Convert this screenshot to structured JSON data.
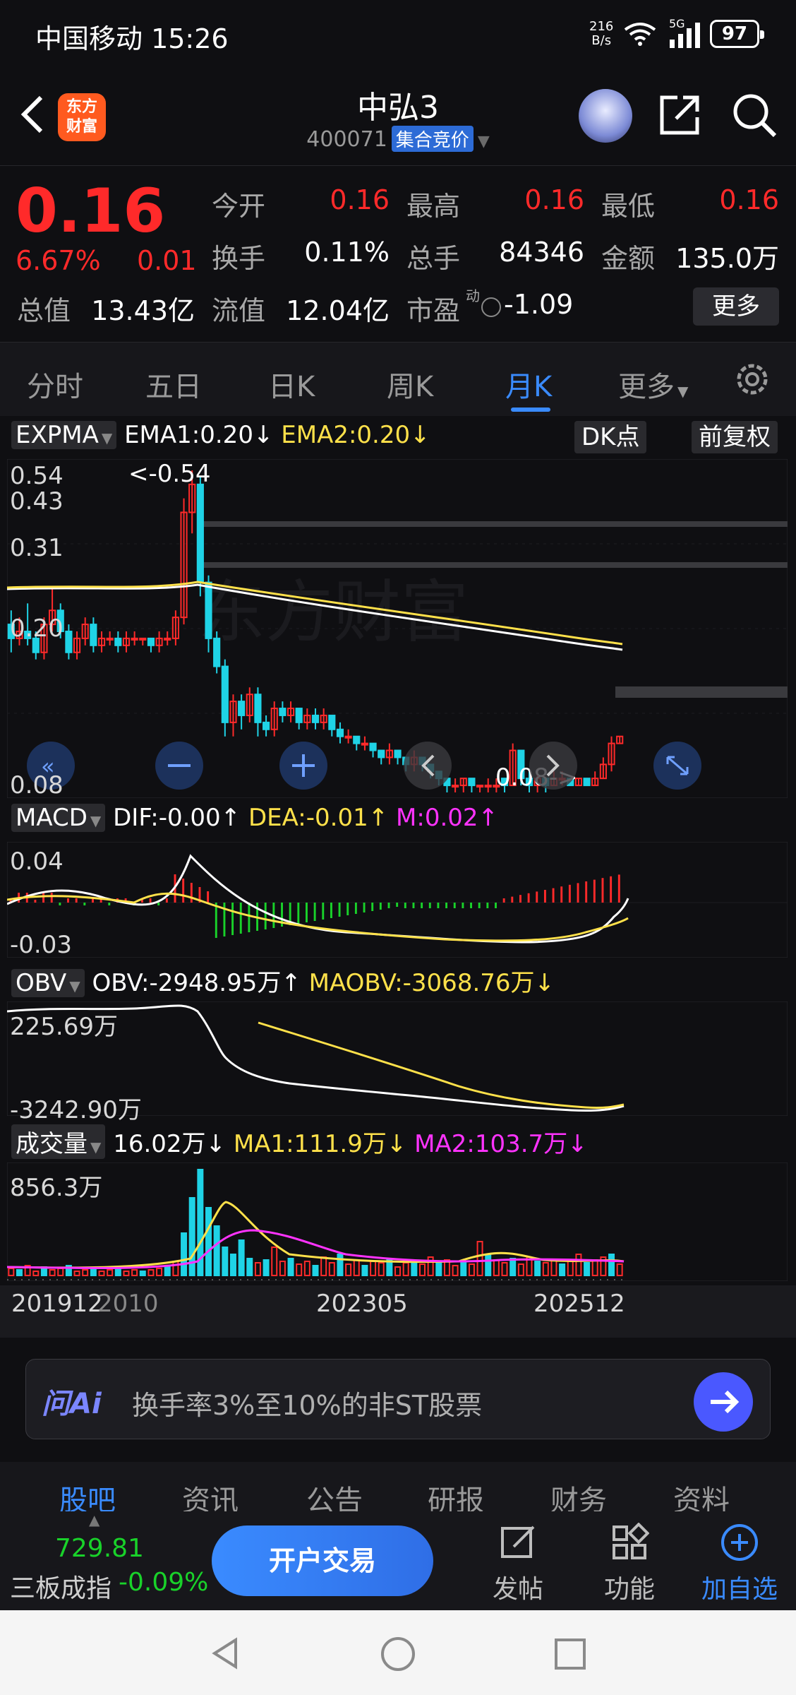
{
  "status": {
    "carrier_time": "中国移动 15:26",
    "net_speed_value": "216",
    "net_speed_unit": "B/s",
    "net_type": "5G",
    "battery": "97"
  },
  "header": {
    "logo": "东方财富",
    "title": "中弘3",
    "code": "400071",
    "auction_tag": "集合竞价"
  },
  "quote": {
    "price": "0.16",
    "change_pct": "6.67%",
    "change": "0.01",
    "open_label": "今开",
    "open": "0.16",
    "high_label": "最高",
    "high": "0.16",
    "low_label": "最低",
    "low": "0.16",
    "turnover_label": "换手",
    "turnover": "0.11%",
    "volume_label": "总手",
    "volume": "84346",
    "amount_label": "金额",
    "amount": "135.0万",
    "mktcap_label": "总值",
    "mktcap": "13.43亿",
    "float_label": "流值",
    "float_cap": "12.04亿",
    "pe_label": "市盈",
    "pe_sup": "动",
    "pe": "-1.09",
    "more": "更多"
  },
  "tabs": [
    {
      "label": "分时"
    },
    {
      "label": "五日"
    },
    {
      "label": "日K"
    },
    {
      "label": "周K"
    },
    {
      "label": "月K"
    },
    {
      "label": "更多"
    }
  ],
  "expma": {
    "name": "EXPMA",
    "ema1": "EMA1:0.20↓",
    "ema2": "EMA2:0.20↓",
    "dk": "DK点",
    "fq": "前复权"
  },
  "macd": {
    "name": "MACD",
    "dif": "DIF:-0.00↑",
    "dea": "DEA:-0.01↑",
    "m": "M:0.02↑"
  },
  "obv": {
    "name": "OBV",
    "obv": "OBV:-2948.95万↑",
    "maobv": "MAOBV:-3068.76万↓"
  },
  "vol": {
    "name": "成交量",
    "v": "16.02万↓",
    "ma1": "MA1:111.9万↓",
    "ma2": "MA2:103.7万↓"
  },
  "colors": {
    "up": "#ff2a2a",
    "down": "#1fd3e6",
    "ema1": "#ffffff",
    "ema2": "#ffe14a",
    "accent": "#3a8bff"
  },
  "chart_data": [
    {
      "type": "candlestick",
      "title": "月K EXPMA",
      "y_tick_labels": [
        "0.54",
        "0.43",
        "0.31",
        "0.20",
        "0.08"
      ],
      "annotations": [
        "<-0.54",
        "0.08->"
      ],
      "series": [
        {
          "name": "EMA1",
          "values": [
            0.3,
            0.3,
            0.3,
            0.3,
            0.3,
            0.3,
            0.29,
            0.28,
            0.27,
            0.26,
            0.25,
            0.24,
            0.23,
            0.22,
            0.21,
            0.2
          ]
        },
        {
          "name": "EMA2",
          "values": [
            0.3,
            0.3,
            0.3,
            0.3,
            0.3,
            0.3,
            0.29,
            0.28,
            0.27,
            0.26,
            0.25,
            0.24,
            0.23,
            0.22,
            0.21,
            0.2
          ]
        }
      ]
    },
    {
      "type": "bar",
      "title": "MACD",
      "y_tick_labels": [
        "0.04",
        "-0.03"
      ]
    },
    {
      "type": "line",
      "title": "OBV",
      "y_tick_labels": [
        "225.69万",
        "-3242.90万"
      ]
    },
    {
      "type": "bar",
      "title": "成交量",
      "y_tick_labels": [
        "856.3万"
      ],
      "x_tick_labels": [
        "201912",
        "2010",
        "202305",
        "202512"
      ]
    }
  ],
  "ai_bar": {
    "logo": "问Ai",
    "prompt": "换手率3%至10%的非ST股票"
  },
  "bottom_tabs": [
    {
      "label": "股吧"
    },
    {
      "label": "资讯"
    },
    {
      "label": "公告"
    },
    {
      "label": "研报"
    },
    {
      "label": "财务"
    },
    {
      "label": "资料"
    }
  ],
  "footer": {
    "index_value": "729.81",
    "index_name": "三板成指",
    "index_change": "-0.09%",
    "trade": "开户交易",
    "post": "发帖",
    "func": "功能",
    "add": "加自选"
  }
}
